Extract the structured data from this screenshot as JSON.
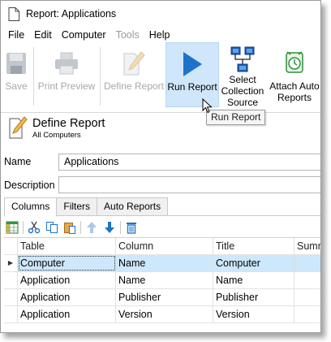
{
  "window": {
    "title": "Report: Applications"
  },
  "menu": [
    {
      "label": "File",
      "enabled": true
    },
    {
      "label": "Edit",
      "enabled": true
    },
    {
      "label": "Computer",
      "enabled": true
    },
    {
      "label": "Tools",
      "enabled": false
    },
    {
      "label": "Help",
      "enabled": true
    }
  ],
  "ribbon": {
    "save": "Save",
    "print_preview": "Print Preview",
    "define_report": "Define Report",
    "run_report": "Run Report",
    "select_source": [
      "Select",
      "Collection",
      "Source"
    ],
    "attach_auto": [
      "Attach Auto",
      "Reports"
    ]
  },
  "tooltip": "Run Report",
  "header": {
    "title": "Define Report",
    "subtitle": "All Computers"
  },
  "form": {
    "name_label": "Name",
    "name_value": "Applications",
    "description_label": "Description",
    "description_value": ""
  },
  "tabs": [
    {
      "label": "Columns",
      "active": true
    },
    {
      "label": "Filters",
      "active": false
    },
    {
      "label": "Auto Reports",
      "active": false
    }
  ],
  "grid": {
    "columns": [
      "Table",
      "Column",
      "Title",
      "Summ"
    ],
    "rows": [
      {
        "table": "Computer",
        "column": "Name",
        "title": "Computer",
        "selected": true
      },
      {
        "table": "Application",
        "column": "Name",
        "title": "Name",
        "selected": false
      },
      {
        "table": "Application",
        "column": "Publisher",
        "title": "Publisher",
        "selected": false
      },
      {
        "table": "Application",
        "column": "Version",
        "title": "Version",
        "selected": false
      }
    ]
  },
  "colors": {
    "accent": "#1e73c8",
    "selection": "#cde7fb",
    "hover": "#cfe6fb"
  }
}
